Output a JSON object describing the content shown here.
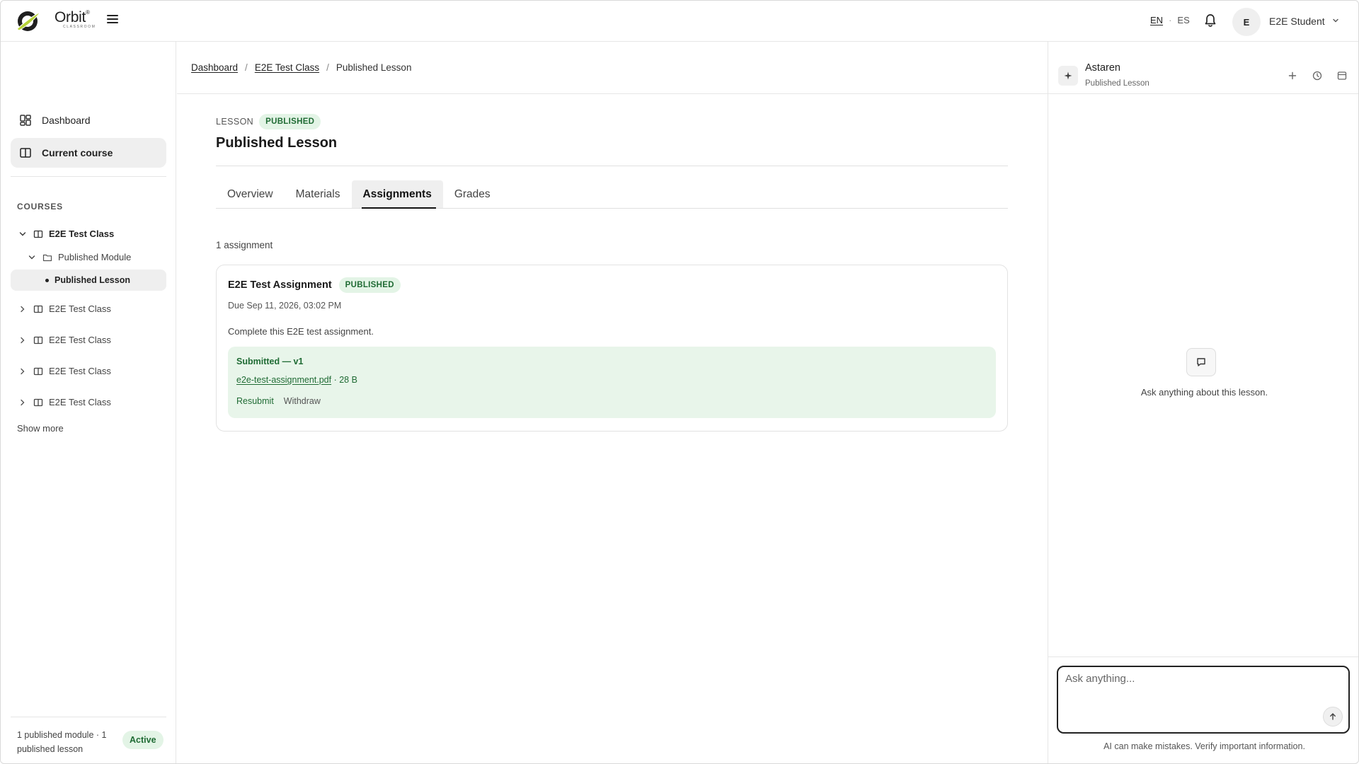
{
  "header": {
    "brand_name": "Orbit",
    "brand_sub": "CLASSROOM",
    "lang_en": "EN",
    "lang_sep": "·",
    "lang_es": "ES",
    "avatar_initial": "E",
    "user_name": "E2E Student"
  },
  "sidebar": {
    "nav": [
      {
        "label": "Dashboard",
        "icon": "dashboard-icon"
      },
      {
        "label": "Current course",
        "icon": "book-icon"
      }
    ],
    "courses_label": "COURSES",
    "tree": {
      "class_name": "E2E Test Class",
      "module_name": "Published Module",
      "lesson_name": "Published Lesson",
      "other_classes": [
        "E2E Test Class",
        "E2E Test Class",
        "E2E Test Class",
        "E2E Test Class"
      ]
    },
    "show_more": "Show more",
    "footer_stats": "1 published module · 1 published lesson",
    "status_badge": "Active"
  },
  "main": {
    "breadcrumb": [
      "Dashboard",
      "E2E Test Class",
      "Published Lesson"
    ],
    "breadcrumb_sep": "/",
    "eyebrow": "LESSON",
    "eyebrow_badge": "PUBLISHED",
    "title": "Published Lesson",
    "tabs": [
      "Overview",
      "Materials",
      "Assignments",
      "Grades"
    ],
    "active_tab": "Assignments",
    "count_text": "1 assignment",
    "assignment": {
      "title": "E2E Test Assignment",
      "badge": "PUBLISHED",
      "due": "Due Sep 11, 2026, 03:02 PM",
      "description": "Complete this E2E test assignment.",
      "submission_status": "Submitted — v1",
      "file_name": "e2e-test-assignment.pdf",
      "file_size": " · 28 B",
      "resubmit": "Resubmit",
      "withdraw": "Withdraw"
    }
  },
  "assistant": {
    "name": "Astaren",
    "context": "Published Lesson",
    "empty_text": "Ask anything about this lesson.",
    "input_placeholder": "Ask anything...",
    "disclaimer": "AI can make mistakes. Verify important information."
  },
  "colors": {
    "accent_green": "#1f6b34",
    "badge_bg": "#e3f4e6",
    "logo_green": "#b7d33a"
  }
}
